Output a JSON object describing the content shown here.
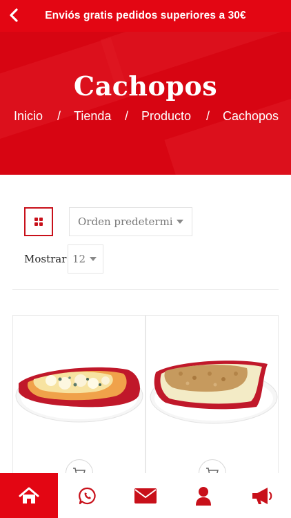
{
  "topbar": {
    "back_icon": "chevron-left-icon",
    "promo_text": "Enviós gratis pedidos superiores a 30€"
  },
  "hero": {
    "title": "Cachopos",
    "breadcrumb": [
      "Inicio",
      "/",
      "Tienda",
      "/",
      "Producto",
      "/",
      "Cachopos"
    ]
  },
  "toolbar": {
    "grid_icon": "grid-view-icon",
    "sort_value": "Orden predeterminado",
    "show_label": "Mostrar",
    "per_page_value": "12"
  },
  "products": [
    {
      "image": "cachopo-cheese-blue",
      "cart_icon": "cart-icon"
    },
    {
      "image": "cachopo-meat-filling",
      "cart_icon": "cart-icon"
    }
  ],
  "bottom_nav": [
    {
      "icon": "home-icon",
      "active": true
    },
    {
      "icon": "whatsapp-icon",
      "active": false
    },
    {
      "icon": "mail-icon",
      "active": false
    },
    {
      "icon": "user-icon",
      "active": false
    },
    {
      "icon": "megaphone-icon",
      "active": false
    }
  ],
  "colors": {
    "brand_red": "#e30613",
    "hero_red": "#d70512",
    "white": "#ffffff"
  }
}
